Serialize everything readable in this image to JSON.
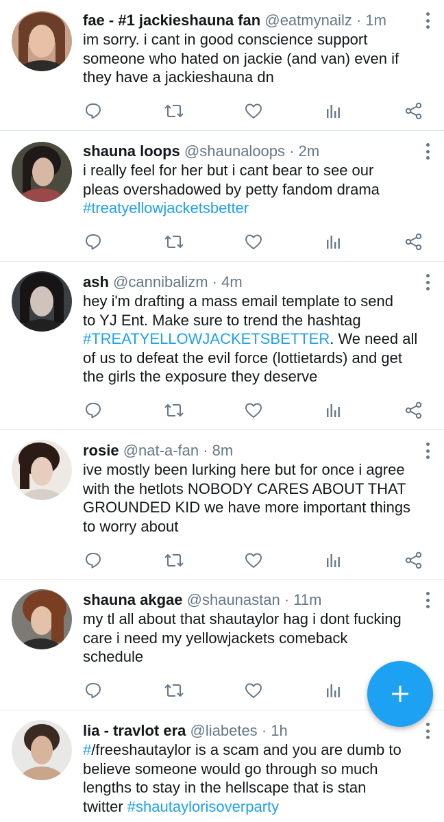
{
  "colors": {
    "accent": "#1da1f2",
    "muted": "#657786",
    "text": "#14171a",
    "divider": "#e1e4e8"
  },
  "icons": [
    "reply-icon",
    "retweet-icon",
    "like-icon",
    "analytics-icon",
    "share-icon",
    "more-icon",
    "compose-icon"
  ],
  "tweets": [
    {
      "name": "fae - #1 jackieshauna fan",
      "handle": "@eatmynailz",
      "time": "· 1m",
      "lines": [
        "im sorry. i cant in good conscience support",
        "someone who hated on jackie (and van) even if",
        "they have a jackieshauna dn"
      ]
    },
    {
      "name": "shauna loops",
      "handle": "@shaunaloops",
      "time": "· 2m",
      "lines": [
        "i really feel for her but i cant bear to see our",
        "pleas overshadowed by petty fandom drama"
      ],
      "hashtag": "#treatyellowjacketsbetter"
    },
    {
      "name": "ash",
      "handle": "@cannibalizm",
      "time": "· 4m",
      "lines": [
        "hey i'm drafting a mass email template to send",
        "to YJ Ent. Make sure to trend the hashtag"
      ],
      "hashtag": "#TREATYELLOWJACKETSBETTER",
      "after_hashtag": ". We need all",
      "lines2": [
        "of us to defeat the evil force (lottietards) and get",
        "the girls the exposure they deserve"
      ]
    },
    {
      "name": "rosie",
      "handle": "@nat-a-fan",
      "time": "· 8m",
      "lines": [
        "ive mostly been lurking here but for once i agree",
        "with the hetlots NOBODY CARES ABOUT THAT",
        "GROUNDED KID we have more important things",
        "to worry about"
      ]
    },
    {
      "name": "shauna akgae",
      "handle": "@shaunastan",
      "time": "· 11m",
      "lines": [
        "my tl all about that shautaylor hag i dont fucking",
        "care i need my yellowjackets comeback",
        "schedule"
      ]
    },
    {
      "name": "lia - travlot era",
      "handle": "@liabetes",
      "time": "· 1h",
      "hashtag_lead": "#",
      "first_line_rest": "/freeshautaylor is a scam and you are dumb to",
      "lines": [
        "believe someone would go through so much",
        "lengths to stay in the hellscape that is stan"
      ],
      "last_prefix": "twitter ",
      "hashtag": "#shautaylorisoverparty"
    }
  ]
}
